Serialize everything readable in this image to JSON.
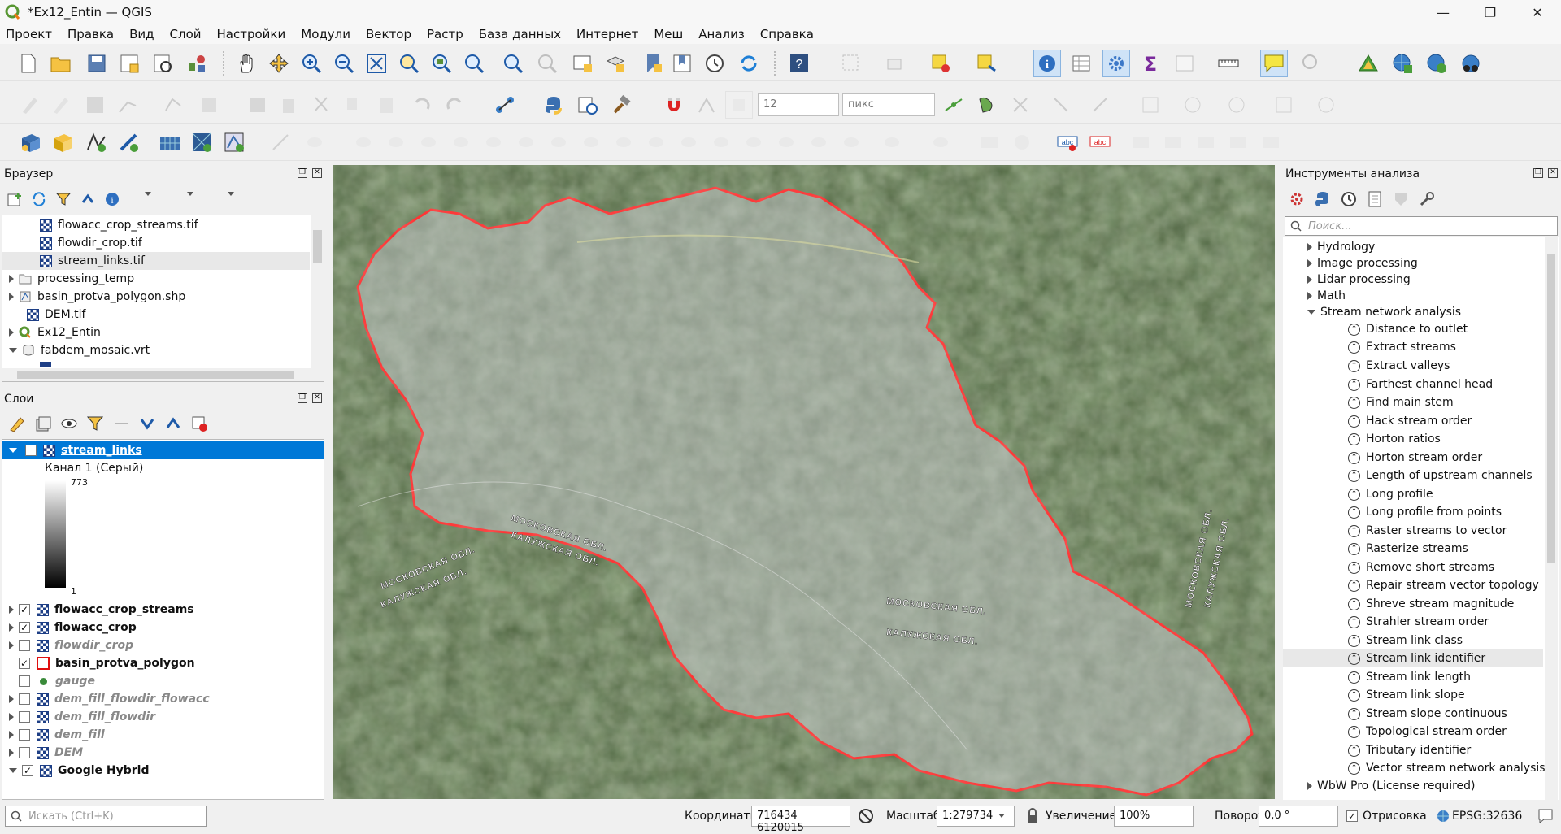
{
  "window": {
    "title": "*Ex12_Entin — QGIS",
    "controls": [
      "—",
      "❐",
      "✕"
    ]
  },
  "menu": [
    "Проект",
    "Правка",
    "Вид",
    "Слой",
    "Настройки",
    "Модули",
    "Вектор",
    "Растр",
    "База данных",
    "Интернет",
    "Меш",
    "Анализ",
    "Справка"
  ],
  "toolbar": {
    "snap_tolerance": "12",
    "snap_units": "пикс"
  },
  "browser": {
    "title": "Браузер",
    "items": [
      {
        "label": "flowacc_crop_streams.tif",
        "icon": "raster-icon"
      },
      {
        "label": "flowdir_crop.tif",
        "icon": "raster-icon"
      },
      {
        "label": "stream_links.tif",
        "icon": "raster-icon"
      },
      {
        "label": "processing_temp",
        "icon": "folder-icon"
      },
      {
        "label": "basin_protva_polygon.shp",
        "icon": "vector-icon"
      },
      {
        "label": "DEM.tif",
        "icon": "raster-icon"
      },
      {
        "label": "Ex12_Entin",
        "icon": "qgis-project-icon"
      },
      {
        "label": "fabdem_mosaic.vrt",
        "icon": "vrt-icon"
      }
    ]
  },
  "layers": {
    "title": "Слои",
    "selected": {
      "label": "stream_links",
      "band": "Канал 1 (Серый)",
      "max": "773",
      "min": "1"
    },
    "items": [
      {
        "label": "flowacc_crop_streams",
        "checked": "✓",
        "style": "bold"
      },
      {
        "label": "flowacc_crop",
        "checked": "✓",
        "style": "bold"
      },
      {
        "label": "flowdir_crop",
        "checked": "",
        "style": "italic"
      },
      {
        "label": "basin_protva_polygon",
        "checked": "✓",
        "style": "bold"
      },
      {
        "label": "gauge",
        "checked": "",
        "style": "italic"
      },
      {
        "label": "dem_fill_flowdir_flowacc",
        "checked": "",
        "style": "italic"
      },
      {
        "label": "dem_fill_flowdir",
        "checked": "",
        "style": "italic"
      },
      {
        "label": "dem_fill",
        "checked": "",
        "style": "italic"
      },
      {
        "label": "DEM",
        "checked": "",
        "style": "italic"
      },
      {
        "label": "Google Hybrid",
        "checked": "✓",
        "style": "bold"
      }
    ]
  },
  "map_labels": {
    "region1": "МОСКОВСКАЯ ОБЛ.",
    "region2": "КАЛУЖСКАЯ ОБЛ.",
    "region3": "МОСКОВСКАЯ ОБЛ.",
    "region4": "КАЛУЖСКАЯ ОБЛ.",
    "region5": "МОСКОВСКАЯ ОБЛ.",
    "region6": "КАЛУЖСКАЯ ОБЛ.",
    "region7": "МОСКОВСКАЯ ОБЛ.",
    "region8": "КАЛУЖСКАЯ ОБЛ."
  },
  "processing": {
    "title": "Инструменты анализа",
    "search_placeholder": "Поиск...",
    "groups": [
      "Hydrology",
      "Image processing",
      "Lidar processing",
      "Math",
      "Stream network analysis"
    ],
    "tools": [
      "Distance to outlet",
      "Extract streams",
      "Extract valleys",
      "Farthest channel head",
      "Find main stem",
      "Hack stream order",
      "Horton ratios",
      "Horton stream order",
      "Length of upstream channels",
      "Long profile",
      "Long profile from points",
      "Raster streams to vector",
      "Rasterize streams",
      "Remove short streams",
      "Repair stream vector topology",
      "Shreve stream magnitude",
      "Strahler stream order",
      "Stream link class",
      "Stream link identifier",
      "Stream link length",
      "Stream link slope",
      "Stream slope continuous",
      "Topological stream order",
      "Tributary identifier",
      "Vector stream network analysis"
    ],
    "last_group": "WbW Pro (License required)"
  },
  "status": {
    "search_placeholder": "Искать (Ctrl+K)",
    "coords_label": "Координаты",
    "coords_value": "716434  6120015",
    "scale_label": "Масштаб",
    "scale_value": "1:279734",
    "zoom_label": "Увеличение",
    "zoom_value": "100%",
    "rotation_label": "Поворот",
    "rotation_value": "0,0 °",
    "render_label": "Отрисовка",
    "crs": "EPSG:32636"
  }
}
